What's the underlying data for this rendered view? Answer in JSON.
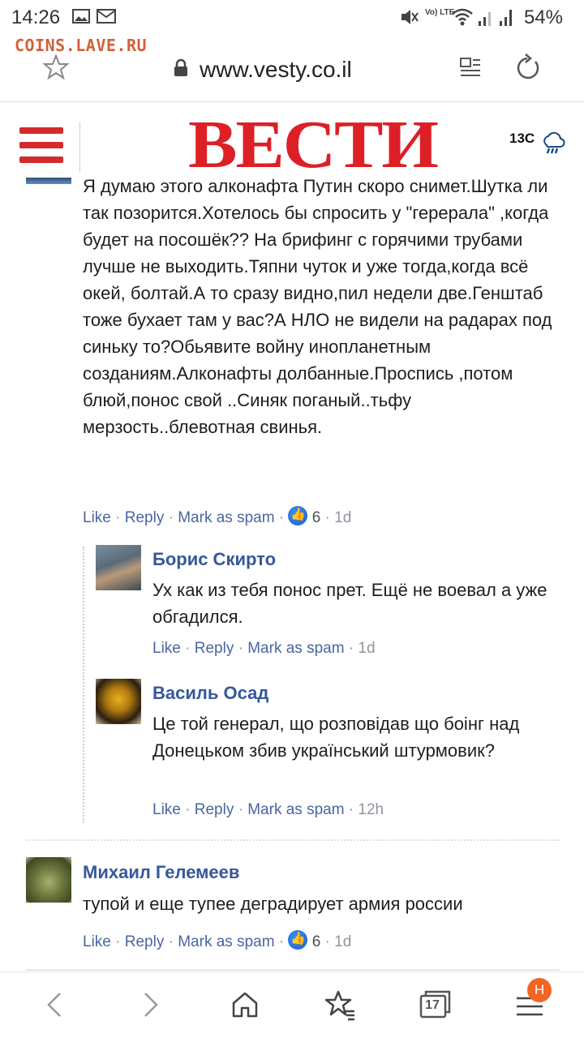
{
  "status_bar": {
    "time": "14:26",
    "battery": "54%",
    "network_label": "Vo) LTE"
  },
  "watermark": "COINS.LAVE.RU",
  "browser": {
    "url": "www.vesty.co.il",
    "tabs_count": "17",
    "menu_badge": "H"
  },
  "site": {
    "logo": "ВЕСТИ",
    "weather_temp": "13C",
    "brand_color": "#dd1f26"
  },
  "comments": [
    {
      "text": "Я думаю этого алконафта Путин скоро снимет.Шутка ли так позорится.Хотелось бы спросить у \"герерала\" ,когда будет на посошёк?? На брифинг с горячими трубами лучше не выходить.Тяпни чуток и уже тогда,когда всё окей, болтай.А то сразу видно,пил недели две.Генштаб тоже бухает там у вас?А НЛО не видели на радарах под синьку то?Обьявите войну инопланетным созданиям.Алконафты долбанные.Проспись ,потом блюй,понос свой ..Синяк поганый..тьфу мерзость..блевотная свинья.",
      "actions": {
        "like": "Like",
        "reply": "Reply",
        "spam": "Mark as spam",
        "likes": "6",
        "time": "1d"
      },
      "replies": [
        {
          "author": "Борис Скирто",
          "text": "Ух как из тебя понос прет. Ещё не воевал а уже обгадился.",
          "actions": {
            "like": "Like",
            "reply": "Reply",
            "spam": "Mark as spam",
            "time": "1d"
          }
        },
        {
          "author": "Василь Осад",
          "text": "Це той генерал, що розповідав що боінг над Донецьком збив український штурмовик?",
          "actions": {
            "like": "Like",
            "reply": "Reply",
            "spam": "Mark as spam",
            "time": "12h"
          }
        }
      ]
    },
    {
      "author": "Михаил Гелемеев",
      "text": "тупой и еще тупее деградирует армия россии",
      "actions": {
        "like": "Like",
        "reply": "Reply",
        "spam": "Mark as spam",
        "likes": "6",
        "time": "1d"
      }
    }
  ],
  "separator": " · "
}
